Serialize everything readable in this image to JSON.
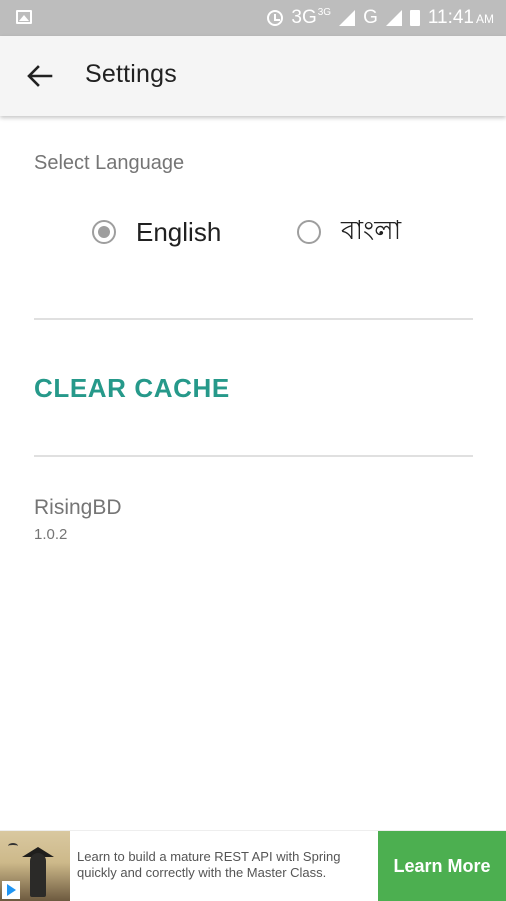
{
  "status_bar": {
    "network_label": "3G",
    "network_sup": "3G",
    "secondary_network": "G",
    "time": "11:41",
    "ampm": "AM"
  },
  "app_bar": {
    "title": "Settings"
  },
  "language": {
    "section_label": "Select Language",
    "options": [
      {
        "label": "English",
        "selected": true
      },
      {
        "label": "বাংলা",
        "selected": false
      }
    ]
  },
  "actions": {
    "clear_cache_label": "CLEAR CACHE"
  },
  "about": {
    "app_name": "RisingBD",
    "version": "1.0.2"
  },
  "ad": {
    "text": "Learn to build a mature REST API with Spring quickly and correctly with the Master Class.",
    "cta_label": "Learn More"
  },
  "colors": {
    "accent": "#26998a",
    "status_bar": "#bdbdbd",
    "app_bar": "#f5f5f5",
    "ad_cta": "#4caf50"
  }
}
